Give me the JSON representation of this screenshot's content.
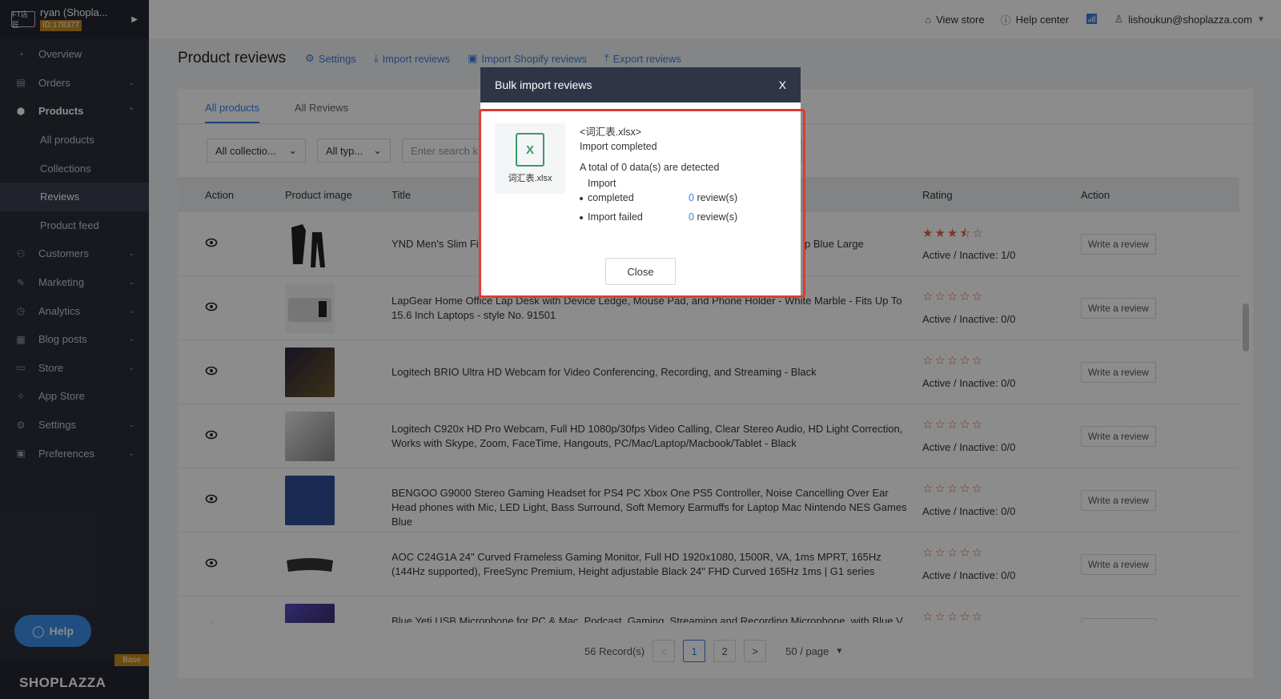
{
  "store": {
    "name": "ryan (Shopla...",
    "id": "ID:178377",
    "logo_text": "FT店匠"
  },
  "topbar": {
    "view_store": "View store",
    "help_center": "Help center",
    "account": "lishoukun@shoplazza.com"
  },
  "sidebar": {
    "items": [
      {
        "label": "Overview",
        "icon": "gauge-icon",
        "type": "top"
      },
      {
        "label": "Orders",
        "icon": "orders-icon",
        "type": "top",
        "chevron": "down"
      },
      {
        "label": "Products",
        "icon": "box-icon",
        "type": "top-active",
        "chevron": "up"
      },
      {
        "label": "All products",
        "type": "sub"
      },
      {
        "label": "Collections",
        "type": "sub"
      },
      {
        "label": "Reviews",
        "type": "sub-active"
      },
      {
        "label": "Product feed",
        "type": "sub"
      },
      {
        "label": "Customers",
        "icon": "users-icon",
        "type": "top",
        "chevron": "down"
      },
      {
        "label": "Marketing",
        "icon": "megaphone-icon",
        "type": "top",
        "chevron": "down"
      },
      {
        "label": "Analytics",
        "icon": "chart-icon",
        "type": "top",
        "chevron": "down"
      },
      {
        "label": "Blog posts",
        "icon": "blog-icon",
        "type": "top",
        "chevron": "down"
      },
      {
        "label": "Store",
        "icon": "store-icon",
        "type": "top",
        "chevron": "down"
      },
      {
        "label": "App Store",
        "icon": "puzzle-icon",
        "type": "top"
      },
      {
        "label": "Settings",
        "icon": "gear-icon",
        "type": "top",
        "chevron": "down"
      },
      {
        "label": "Preferences",
        "icon": "monitor-icon",
        "type": "top",
        "chevron": "down"
      }
    ],
    "help_label": "Help",
    "base_tag": "Base",
    "brand": "SHOPLAZZA"
  },
  "page": {
    "title": "Product reviews",
    "links": {
      "settings": "Settings",
      "import": "Import reviews",
      "import_shopify": "Import Shopify reviews",
      "export": "Export reviews"
    }
  },
  "tabs": {
    "all_products": "All products",
    "all_reviews": "All Reviews"
  },
  "filters": {
    "collection": "All collectio...",
    "type": "All typ...",
    "search_placeholder": "Enter search k"
  },
  "table": {
    "headers": {
      "action": "Action",
      "image": "Product image",
      "title": "Title",
      "rating": "Rating",
      "action2": "Action"
    },
    "write_label": "Write a review",
    "rows": [
      {
        "title": "YND Men's Slim Fit Suit ... Top Blue Large",
        "title_a": "YND Men's Slim Fit",
        "title_b": "p Blue Large",
        "stars": "★★★⯪☆",
        "status": "Active / Inactive: 1/0"
      },
      {
        "title": "LapGear Home Office Lap Desk with Device Ledge, Mouse Pad, and Phone Holder - White Marble - Fits Up To 15.6 Inch Laptops - style No. 91501",
        "stars": "☆☆☆☆☆",
        "status": "Active / Inactive: 0/0"
      },
      {
        "title": "Logitech BRIO Ultra HD Webcam for Video Conferencing, Recording, and Streaming - Black",
        "stars": "☆☆☆☆☆",
        "status": "Active / Inactive: 0/0"
      },
      {
        "title": "Logitech C920x HD Pro Webcam, Full HD 1080p/30fps Video Calling, Clear Stereo Audio, HD Light Correction, Works with Skype, Zoom, FaceTime, Hangouts, PC/Mac/Laptop/Macbook/Tablet - Black",
        "stars": "☆☆☆☆☆",
        "status": "Active / Inactive: 0/0"
      },
      {
        "title": "BENGOO G9000 Stereo Gaming Headset for PS4 PC Xbox One PS5 Controller, Noise Cancelling Over Ear Head phones with Mic, LED Light, Bass Surround, Soft Memory Earmuffs for Laptop Mac Nintendo NES Games Blue",
        "stars": "☆☆☆☆☆",
        "status": "Active / Inactive: 0/0"
      },
      {
        "title": "AOC C24G1A 24\" Curved Frameless Gaming Monitor, Full HD 1920x1080, 1500R, VA, 1ms MPRT, 165Hz (144Hz supported), FreeSync Premium, Height adjustable Black 24\" FHD Curved 165Hz 1ms | G1 series",
        "stars": "☆☆☆☆☆",
        "status": "Active / Inactive: 0/0"
      },
      {
        "title": "Blue Yeti USB Microphone for PC & Mac, Podcast, Gaming, Streaming and Recording Microphone, with Blue V",
        "stars": "☆☆☆☆☆",
        "status": ""
      }
    ]
  },
  "pager": {
    "records": "56 Record(s)",
    "prev": "<",
    "page1": "1",
    "page2": "2",
    "next": ">",
    "per_page": "50 / page"
  },
  "modal": {
    "title": "Bulk import reviews",
    "close_x": "X",
    "file_name": "<词汇表.xlsx>",
    "file_label": "词汇表.xlsx",
    "file_glyph": "X",
    "status": "Import completed",
    "total": "A total of 0 data(s) are detected",
    "completed_label_1": "Import",
    "completed_label_2": "completed",
    "completed_count": "0",
    "failed_label": "Import failed",
    "failed_count": "0",
    "unit": "review(s)",
    "close_button": "Close"
  },
  "colors": {
    "accent": "#3b7fe0",
    "sidebar": "#2b2f3a",
    "star": "#e0653f",
    "highlight": "#e03b30",
    "excel": "#3a9a62"
  }
}
